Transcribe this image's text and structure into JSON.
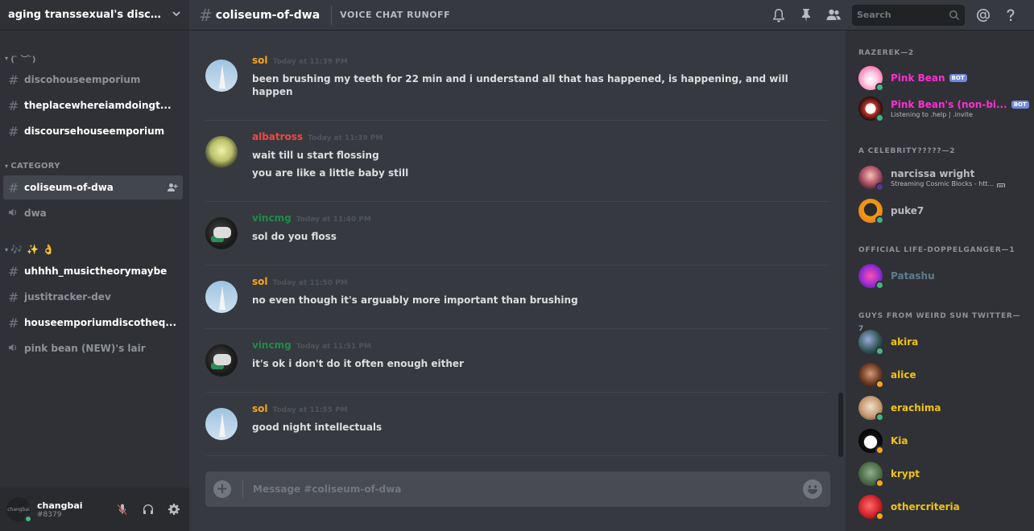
{
  "server": {
    "name": "aging transsexual's disco ...",
    "chevron": "chevron-down-icon"
  },
  "channel_header": {
    "hash": "#",
    "name": "coliseum-of-dwa",
    "topic": "VOICE CHAT RUNOFF"
  },
  "search": {
    "placeholder": "Search"
  },
  "sidebar": {
    "categories": [
      {
        "label": "( ̄ ︶  ̄)",
        "channels": [
          {
            "type": "text",
            "name": "discohouseemporium",
            "unread": false
          },
          {
            "type": "text",
            "name": "theplacewhereiamdoingt...",
            "unread": true
          },
          {
            "type": "text",
            "name": "discoursehouseemporium",
            "unread": true
          }
        ]
      },
      {
        "label": "CATEGORY",
        "channels": [
          {
            "type": "text",
            "name": "coliseum-of-dwa",
            "unread": true,
            "active": true
          },
          {
            "type": "voice",
            "name": "dwa",
            "unread": false
          }
        ]
      },
      {
        "label": "🎶 ✨ 👌",
        "channels": [
          {
            "type": "text",
            "name": "uhhhh_musictheorymaybe",
            "unread": true
          },
          {
            "type": "text",
            "name": "justitracker-dev",
            "unread": false
          },
          {
            "type": "text",
            "name": "houseemporiumdiscotheq...",
            "unread": true
          },
          {
            "type": "voice",
            "name": "pink bean (NEW)'s lair",
            "unread": false
          }
        ]
      }
    ]
  },
  "user": {
    "name": "changbai",
    "tag": "#8379",
    "avatar_text": "changbai"
  },
  "messages": [
    {
      "author": "sol",
      "color": "#faa61a",
      "avatar": "sol",
      "time": "Today at 11:39 PM",
      "lines": [
        "been brushing my teeth for 22 min and i understand all that has happened, is happening, and will happen"
      ]
    },
    {
      "author": "albatross",
      "color": "#f04747",
      "avatar": "albatross",
      "time": "Today at 11:39 PM",
      "lines": [
        "wait till u start flossing",
        "you are like a little baby still"
      ]
    },
    {
      "author": "vincmg",
      "color": "#1f8b4c",
      "avatar": "vincmg",
      "time": "Today at 11:40 PM",
      "lines": [
        "sol do you floss"
      ]
    },
    {
      "author": "sol",
      "color": "#faa61a",
      "avatar": "sol",
      "time": "Today at 11:50 PM",
      "lines": [
        "no even though it's arguably more important than brushing"
      ]
    },
    {
      "author": "vincmg",
      "color": "#1f8b4c",
      "avatar": "vincmg",
      "time": "Today at 11:51 PM",
      "lines": [
        "it's ok i don't do it often enough either"
      ]
    },
    {
      "author": "sol",
      "color": "#faa61a",
      "avatar": "sol",
      "time": "Today at 11:55 PM",
      "lines": [
        "good night intellectuals"
      ]
    }
  ],
  "composer": {
    "placeholder": "Message #coliseum-of-dwa"
  },
  "members": {
    "groups": [
      {
        "label": "RAZEREK—2",
        "members": [
          {
            "name": "Pink Bean",
            "color": "#ff2ed3",
            "bot": "BOT",
            "status": "online",
            "activity": ""
          },
          {
            "name": "Pink Bean's (non-bi...",
            "color": "#ff2ed3",
            "bot": "BOT",
            "status": "online",
            "activity": "Listening to .help | .invite"
          }
        ]
      },
      {
        "label": "A CELEBRITY?????—2",
        "members": [
          {
            "name": "narcissa wright",
            "color": "#b9bbbe",
            "bot": "",
            "status": "streaming",
            "activity": "Streaming Cosmic Blocks - htt..."
          },
          {
            "name": "puke7",
            "color": "#b9bbbe",
            "bot": "",
            "status": "online",
            "activity": ""
          }
        ]
      },
      {
        "label": "OFFICIAL LIFE-DOPPELGANGER—1",
        "members": [
          {
            "name": "Patashu",
            "color": "#607d8b",
            "bot": "",
            "status": "online",
            "activity": ""
          }
        ]
      },
      {
        "label": "GUYS FROM WEIRD SUN TWITTER—7",
        "members": [
          {
            "name": "akira",
            "color": "#f1c40f",
            "bot": "",
            "status": "online",
            "activity": ""
          },
          {
            "name": "alice",
            "color": "#f1c40f",
            "bot": "",
            "status": "idle",
            "activity": ""
          },
          {
            "name": "erachima",
            "color": "#f1c40f",
            "bot": "",
            "status": "online",
            "activity": ""
          },
          {
            "name": "Kia",
            "color": "#f1c40f",
            "bot": "",
            "status": "idle",
            "activity": ""
          },
          {
            "name": "krypt",
            "color": "#f1c40f",
            "bot": "",
            "status": "idle",
            "activity": ""
          },
          {
            "name": "othercriteria",
            "color": "#f1c40f",
            "bot": "",
            "status": "idle",
            "activity": ""
          }
        ]
      }
    ]
  },
  "colors": {
    "online": "#43b581",
    "idle": "#faa61a",
    "streaming": "#593695",
    "accent": "#7289da"
  }
}
